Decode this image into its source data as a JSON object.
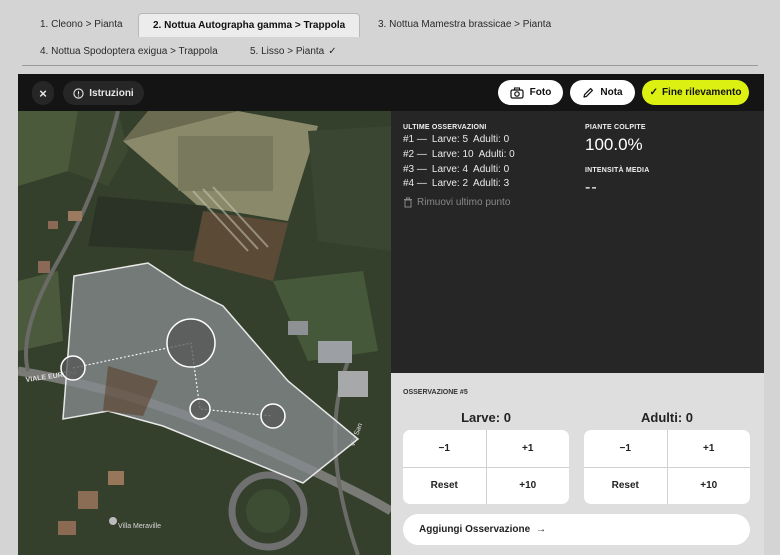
{
  "tabs": [
    {
      "label": "1. Cleono > Pianta",
      "active": false
    },
    {
      "label": "2. Nottua Autographa gamma > Trappola",
      "active": true
    },
    {
      "label": "3. Nottua Mamestra brassicae > Pianta",
      "active": false
    },
    {
      "label": "4. Nottua Spodoptera exigua > Trappola",
      "active": false
    },
    {
      "label": "5. Lisso > Pianta",
      "active": false,
      "check": "✓"
    }
  ],
  "toolbar": {
    "close_label": "×",
    "instructions_label": "Istruzioni",
    "photo_label": "Foto",
    "note_label": "Nota",
    "finish_label": "Fine rilevamento",
    "finish_check": "✓"
  },
  "observations": {
    "title": "ULTIME OSSERVAZIONI",
    "items": [
      {
        "num": "#1 —",
        "larve": "Larve: 5",
        "adulti": "Adulti: 0"
      },
      {
        "num": "#2 —",
        "larve": "Larve: 10",
        "adulti": "Adulti: 0"
      },
      {
        "num": "#3 —",
        "larve": "Larve: 4",
        "adulti": "Adulti: 0"
      },
      {
        "num": "#4 —",
        "larve": "Larve: 2",
        "adulti": "Adulti: 3"
      }
    ],
    "remove_label": "Rimuovi ultimo punto"
  },
  "stats": {
    "affected_title": "PIANTE COLPITE",
    "affected_value": "100.0%",
    "intensity_title": "INTENSITÀ MEDIA",
    "intensity_value": "--"
  },
  "current": {
    "title": "OSSERVAZIONE #5",
    "larve_label": "Larve: 0",
    "adulti_label": "Adulti: 0",
    "buttons": {
      "minus1": "−1",
      "plus1": "+1",
      "reset": "Reset",
      "plus10": "+10"
    },
    "add_label": "Aggiungi Osservazione",
    "add_arrow": "→"
  },
  "map": {
    "labels": {
      "street": "VIALE EUROPA",
      "place": "Villa Meraville",
      "road": "Via San"
    }
  },
  "colors": {
    "accent": "#dcf012",
    "panel": "#262626",
    "topbar": "#141414"
  }
}
